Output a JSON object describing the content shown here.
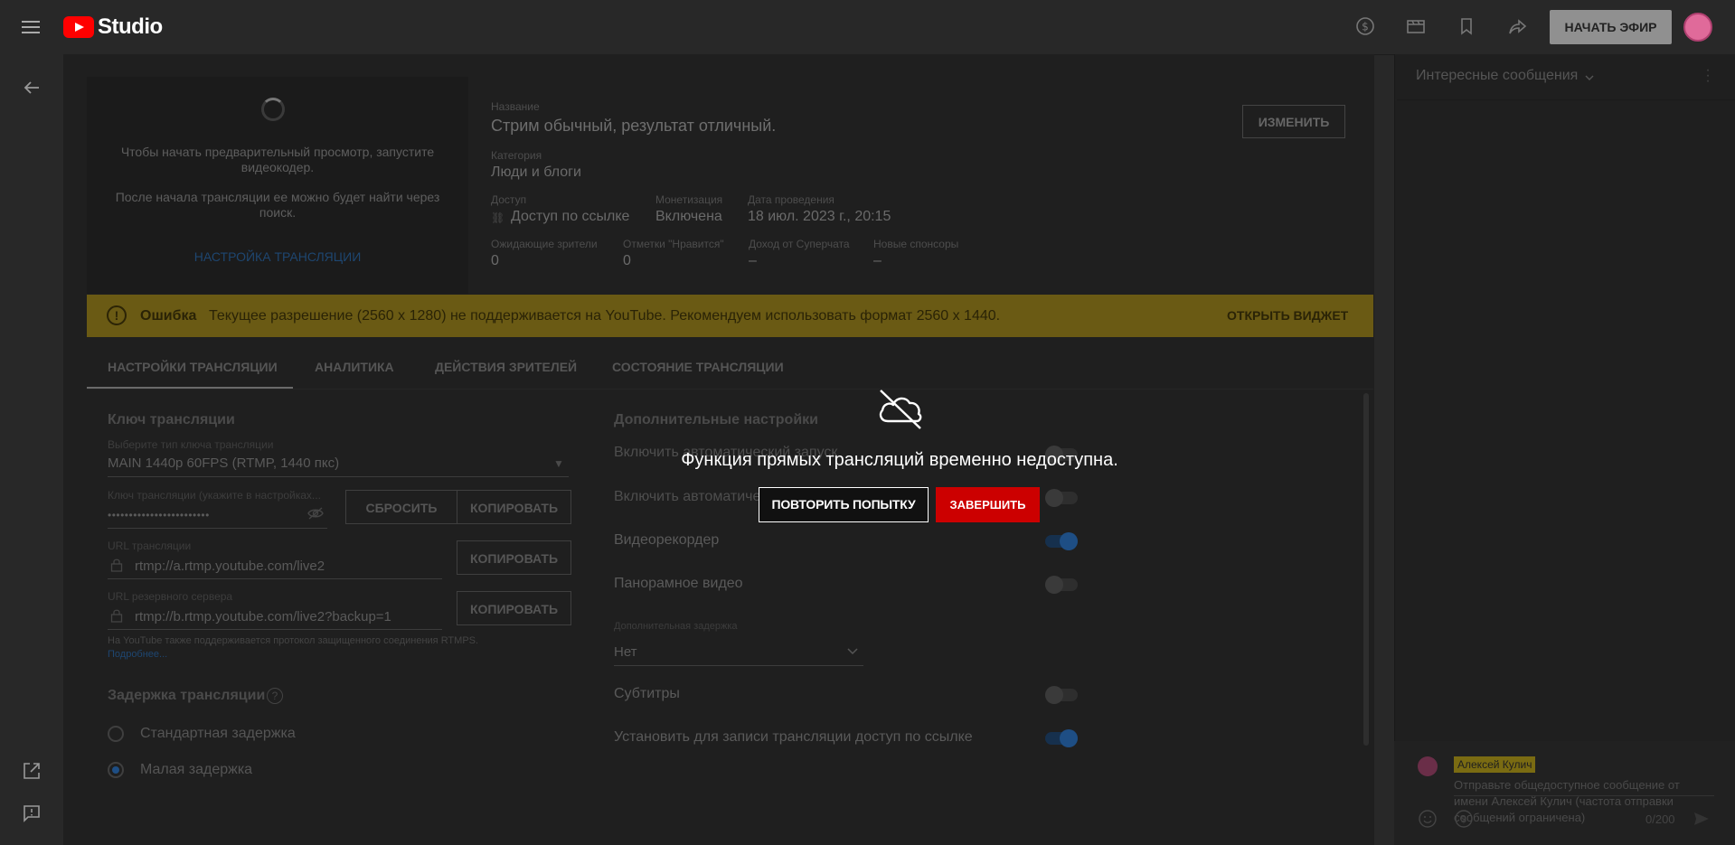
{
  "header": {
    "logo_text": "Studio",
    "go_live_label": "НАЧАТЬ ЭФИР",
    "icons": [
      "hamburger-icon",
      "dollar-icon",
      "clapperboard-icon",
      "bookmark-icon",
      "share-icon"
    ]
  },
  "preview": {
    "message1": "Чтобы начать предварительный просмотр, запустите видеокодер.",
    "message2": "После начала трансляции ее можно будет найти через поиск.",
    "link": "НАСТРОЙКА ТРАНСЛЯЦИИ"
  },
  "info": {
    "title_label": "Название",
    "title_value": "Стрим обычный, результат отличный.",
    "category_label": "Категория",
    "category_value": "Люди и блоги",
    "access_label": "Доступ",
    "access_value": "Доступ по ссылке",
    "monetization_label": "Монетизация",
    "monetization_value": "Включена",
    "date_label": "Дата проведения",
    "date_value": "18 июл. 2023 г., 20:15",
    "waiting_label": "Ожидающие зрители",
    "waiting_value": "0",
    "likes_label": "Отметки \"Нравится\"",
    "likes_value": "0",
    "superchat_label": "Доход от Суперчата",
    "superchat_value": "–",
    "sponsors_label": "Новые спонсоры",
    "sponsors_value": "–",
    "edit_label": "ИЗМЕНИТЬ"
  },
  "error_bar": {
    "label": "Ошибка",
    "message": "Текущее разрешение (2560 x 1280) не поддерживается на YouTube. Рекомендуем использовать формат 2560 x 1440.",
    "action": "ОТКРЫТЬ ВИДЖЕТ"
  },
  "tabs": [
    {
      "label": "НАСТРОЙКИ ТРАНСЛЯЦИИ",
      "active": true
    },
    {
      "label": "АНАЛИТИКА"
    },
    {
      "label": "ДЕЙСТВИЯ ЗРИТЕЛЕЙ"
    },
    {
      "label": "СОСТОЯНИЕ ТРАНСЛЯЦИИ"
    }
  ],
  "stream_key": {
    "heading": "Ключ трансляции",
    "type_label": "Выберите тип ключа трансляции",
    "type_value": "MAIN 1440p 60FPS (RTMP, 1440 пкс)",
    "key_label": "Ключ трансляции (укажите в настройках...",
    "key_value": "••••••••••••••••••••••••",
    "reset_label": "СБРОСИТЬ",
    "copy_label": "КОПИРОВАТЬ",
    "url_label": "URL трансляции",
    "url_value": "rtmp://a.rtmp.youtube.com/live2",
    "backup_label": "URL резервного сервера",
    "backup_value": "rtmp://b.rtmp.youtube.com/live2?backup=1",
    "rtmps_note": "На YouTube также поддерживается протокол защищенного соединения RTMPS.",
    "more_link": "Подробнее..."
  },
  "latency": {
    "heading": "Задержка трансляции",
    "option_standard": "Стандартная задержка",
    "option_low": "Малая задержка"
  },
  "additional": {
    "heading": "Дополнительные настройки",
    "auto_start": "Включить автоматический запуск",
    "auto_stop": "Включить автоматическое завершение",
    "dvr": "Видеорекордер",
    "dvr_on": true,
    "panoramic": "Панорамное видео",
    "delay_label": "Дополнительная задержка",
    "delay_value": "Нет",
    "subtitles": "Субтитры",
    "unlisted_record": "Установить для записи трансляции доступ по ссылке",
    "unlisted_on": true
  },
  "chat": {
    "mode": "Интересные сообщения",
    "user_name": "Алексей Кулич",
    "placeholder": "Отправьте общедоступное сообщение от имени Алексей Кулич (частота отправки сообщений ограничена)",
    "counter": "0/200"
  },
  "modal": {
    "title": "Функция прямых трансляций временно недоступна.",
    "retry_label": "ПОВТОРИТЬ ПОПЫТКУ",
    "finish_label": "ЗАВЕРШИТЬ",
    "icon": "cloud-off-icon"
  },
  "colors": {
    "finish_button": "#cc0000",
    "error_bar": "#6a5a14",
    "brand": "#ff0000"
  }
}
